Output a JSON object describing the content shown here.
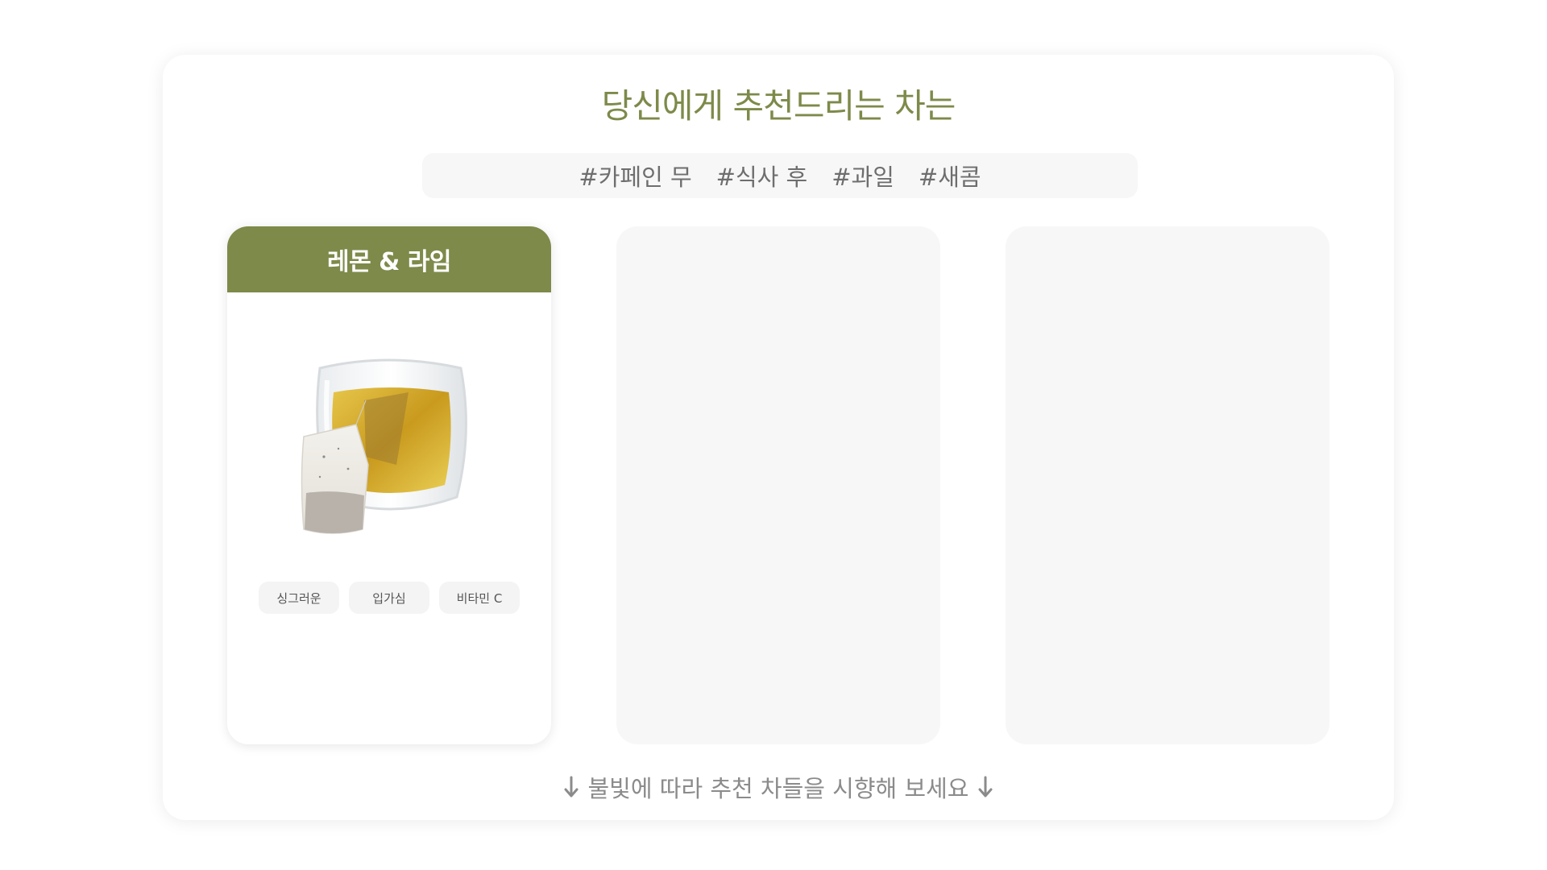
{
  "title": "당신에게 추천드리는 차는",
  "hashtags": [
    "#카페인 무",
    "#식사 후",
    "#과일",
    "#새콤"
  ],
  "cards": [
    {
      "name": "레몬 & 라임",
      "chips": [
        "싱그러운",
        "입가심",
        "비타민 C"
      ]
    }
  ],
  "footer": "불빛에 따라 추천 차들을 시향해 보세요",
  "colors": {
    "accent": "#7d8a4a",
    "muted_bg": "#f7f7f7",
    "text_muted": "#8b8b8b"
  },
  "icons": {
    "footer_left": "arrow-down-icon",
    "footer_right": "arrow-down-icon",
    "tea": "tea-cup-with-teabag"
  }
}
